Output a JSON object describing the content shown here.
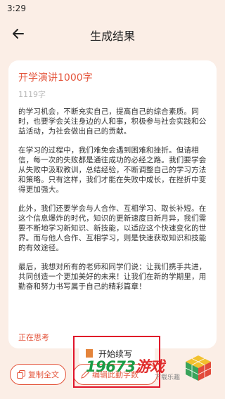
{
  "status_bar": {
    "time": "3:29"
  },
  "nav": {
    "title": "生成结果",
    "back_icon": "back-arrow-icon"
  },
  "card": {
    "title": "开学演讲1000字",
    "count": "1119字",
    "paragraphs": [
      "的学习机会，不断充实自己，提高自己的综合素质。同时，也要学会关注身边的人和事，积极参与社会实践和公益活动，为社会做出自己的贡献。",
      "在学习的过程中，我们难免会遇到困难和挫折。但请相信，每一次的失败都是通往成功的必经之路。我们要学会从失败中汲取教训，总结经验，不断调整自己的学习方法和策略。只有这样，我们才能在失败中成长，在挫折中变得更加强大。",
      "此外，我们还要学会与人合作、互相学习、取长补短。在这个信息爆炸的时代，知识的更新速度日新月异，我们需要不断地学习新知识、新技能，以适应这个快速变化的世界。而与他人合作、互相学习，则是快速获取知识和技能的有效途径。",
      "最后，我想对所有的老师和同学们说：让我们携手共进，共同创造一个更加美好的未来！让我们在新的学期里，用勤奋和努力书写属于自己的精彩篇章！"
    ],
    "status": "正在思考"
  },
  "bottom": {
    "copy_label": "复制全文",
    "edit_label": "编辑此勤字数",
    "popup_label": "开始续写"
  },
  "watermark": {
    "main": "19673",
    "accent": "游戏",
    "sub": "下载乐趣"
  },
  "colors": {
    "accent": "#e4543b",
    "background": "#fbeee6",
    "highlight": "#e0142a"
  }
}
